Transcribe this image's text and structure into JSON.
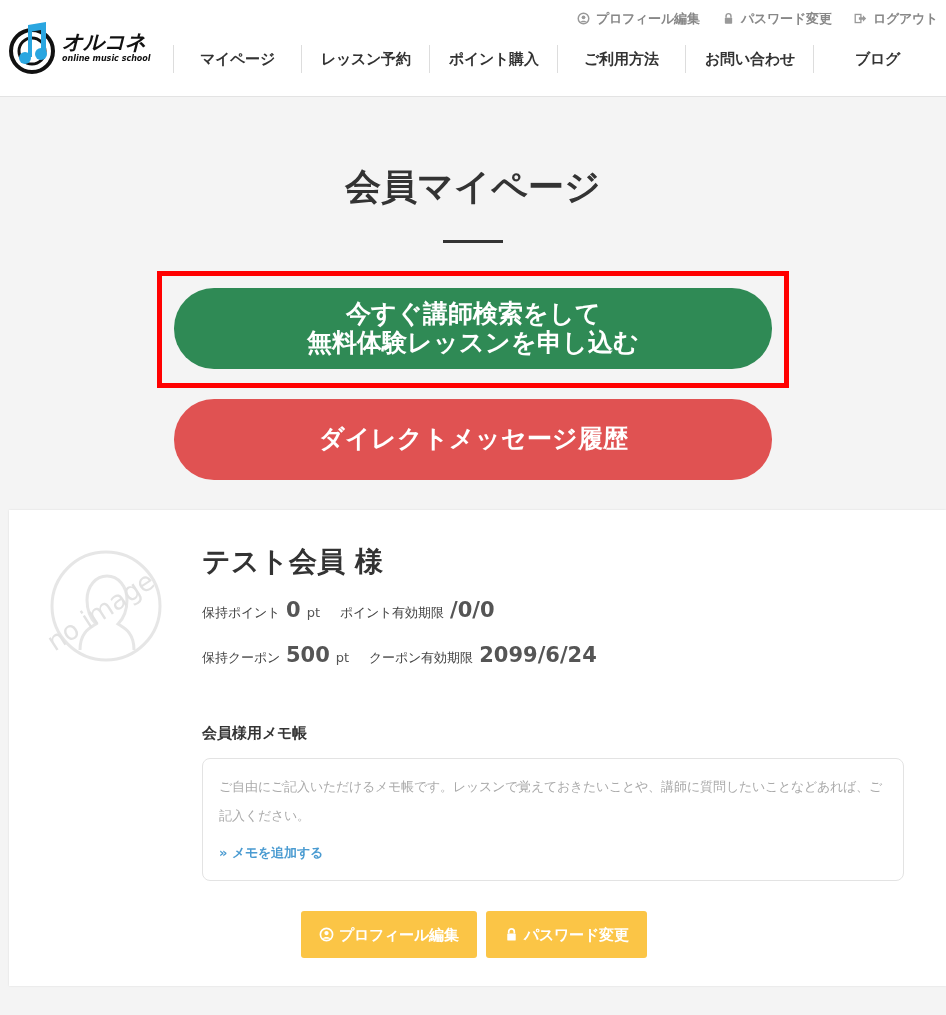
{
  "header": {
    "logo": {
      "name": "オルコネ",
      "tagline": "online music school"
    },
    "top_links": [
      {
        "kind": "profile",
        "label": "プロフィール編集"
      },
      {
        "kind": "lock",
        "label": "パスワード変更"
      },
      {
        "kind": "logout",
        "label": "ログアウト"
      }
    ],
    "nav": [
      "マイページ",
      "レッスン予約",
      "ポイント購入",
      "ご利用方法",
      "お問い合わせ",
      "ブログ"
    ]
  },
  "page_title": "会員マイページ",
  "actions": [
    {
      "kind": "search",
      "lines": [
        "今すぐ講師検索をして",
        "無料体験レッスンを申し込む"
      ],
      "highlighted": true
    },
    {
      "kind": "messages",
      "lines": [
        "ダイレクトメッセージ履歴"
      ],
      "highlighted": false
    }
  ],
  "member": {
    "avatar_text": "no image",
    "name": "テスト会員 様",
    "stats": [
      [
        {
          "label": "保持ポイント",
          "value": "0",
          "unit": "pt"
        },
        {
          "label": "ポイント有効期限",
          "value": "/0/0"
        }
      ],
      [
        {
          "label": "保持クーポン",
          "value": "500",
          "unit": "pt"
        },
        {
          "label": "クーポン有効期限",
          "value": "2099/6/24"
        }
      ]
    ],
    "memo": {
      "title": "会員様用メモ帳",
      "text": "ご自由にご記入いただけるメモ帳です。レッスンで覚えておきたいことや、講師に質問したいことなどあれば、ご記入ください。",
      "link": "» メモを追加する"
    },
    "buttons": [
      {
        "kind": "profile",
        "label": "プロフィール編集"
      },
      {
        "kind": "lock",
        "label": "パスワード変更"
      }
    ]
  }
}
